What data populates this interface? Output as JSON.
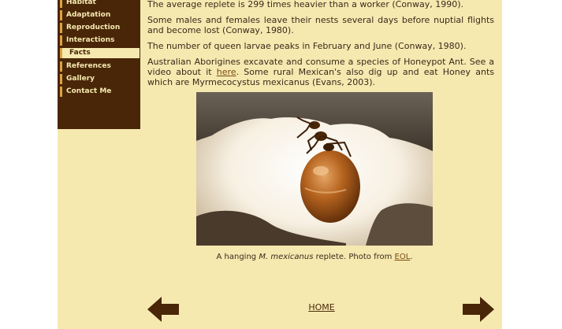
{
  "sidebar": {
    "items": [
      {
        "label": "Habitat"
      },
      {
        "label": "Adaptation"
      },
      {
        "label": "Reproduction"
      },
      {
        "label": "Interactions"
      },
      {
        "label": "Facts"
      },
      {
        "label": "References"
      },
      {
        "label": "Gallery"
      },
      {
        "label": "Contact Me"
      }
    ],
    "active": "Facts"
  },
  "content": {
    "fact1": "The average replete is 299 times heavier than a worker (Conway, 1990).",
    "fact2": "Some males and females leave their nests several days before nuptial flights and become lost (Conway, 1980).",
    "fact3": "The number of queen larvae peaks in February and June (Conway, 1980).",
    "fact4_part1": "Australian Aborigines excavate and consume a species of Honeypot Ant. See a video about it ",
    "fact4_link": "here",
    "fact4_part2": ". Some rural Mexican's also dig up and eat Honey ants which are Myrmecocystus mexicanus (Evans, 2003)."
  },
  "figure": {
    "caption_prefix": "A hanging ",
    "caption_species": "M. mexicanus",
    "caption_mid": " replete. Photo from ",
    "caption_link": "EOL",
    "caption_end": "."
  },
  "footer": {
    "home_label": "HOME",
    "prev_icon": "left-arrow-icon",
    "next_icon": "right-arrow-icon"
  },
  "colors": {
    "background": "#f5e9b0",
    "sidebar": "#4a2608",
    "accent": "#d9a441",
    "arrow": "#4a2608"
  }
}
